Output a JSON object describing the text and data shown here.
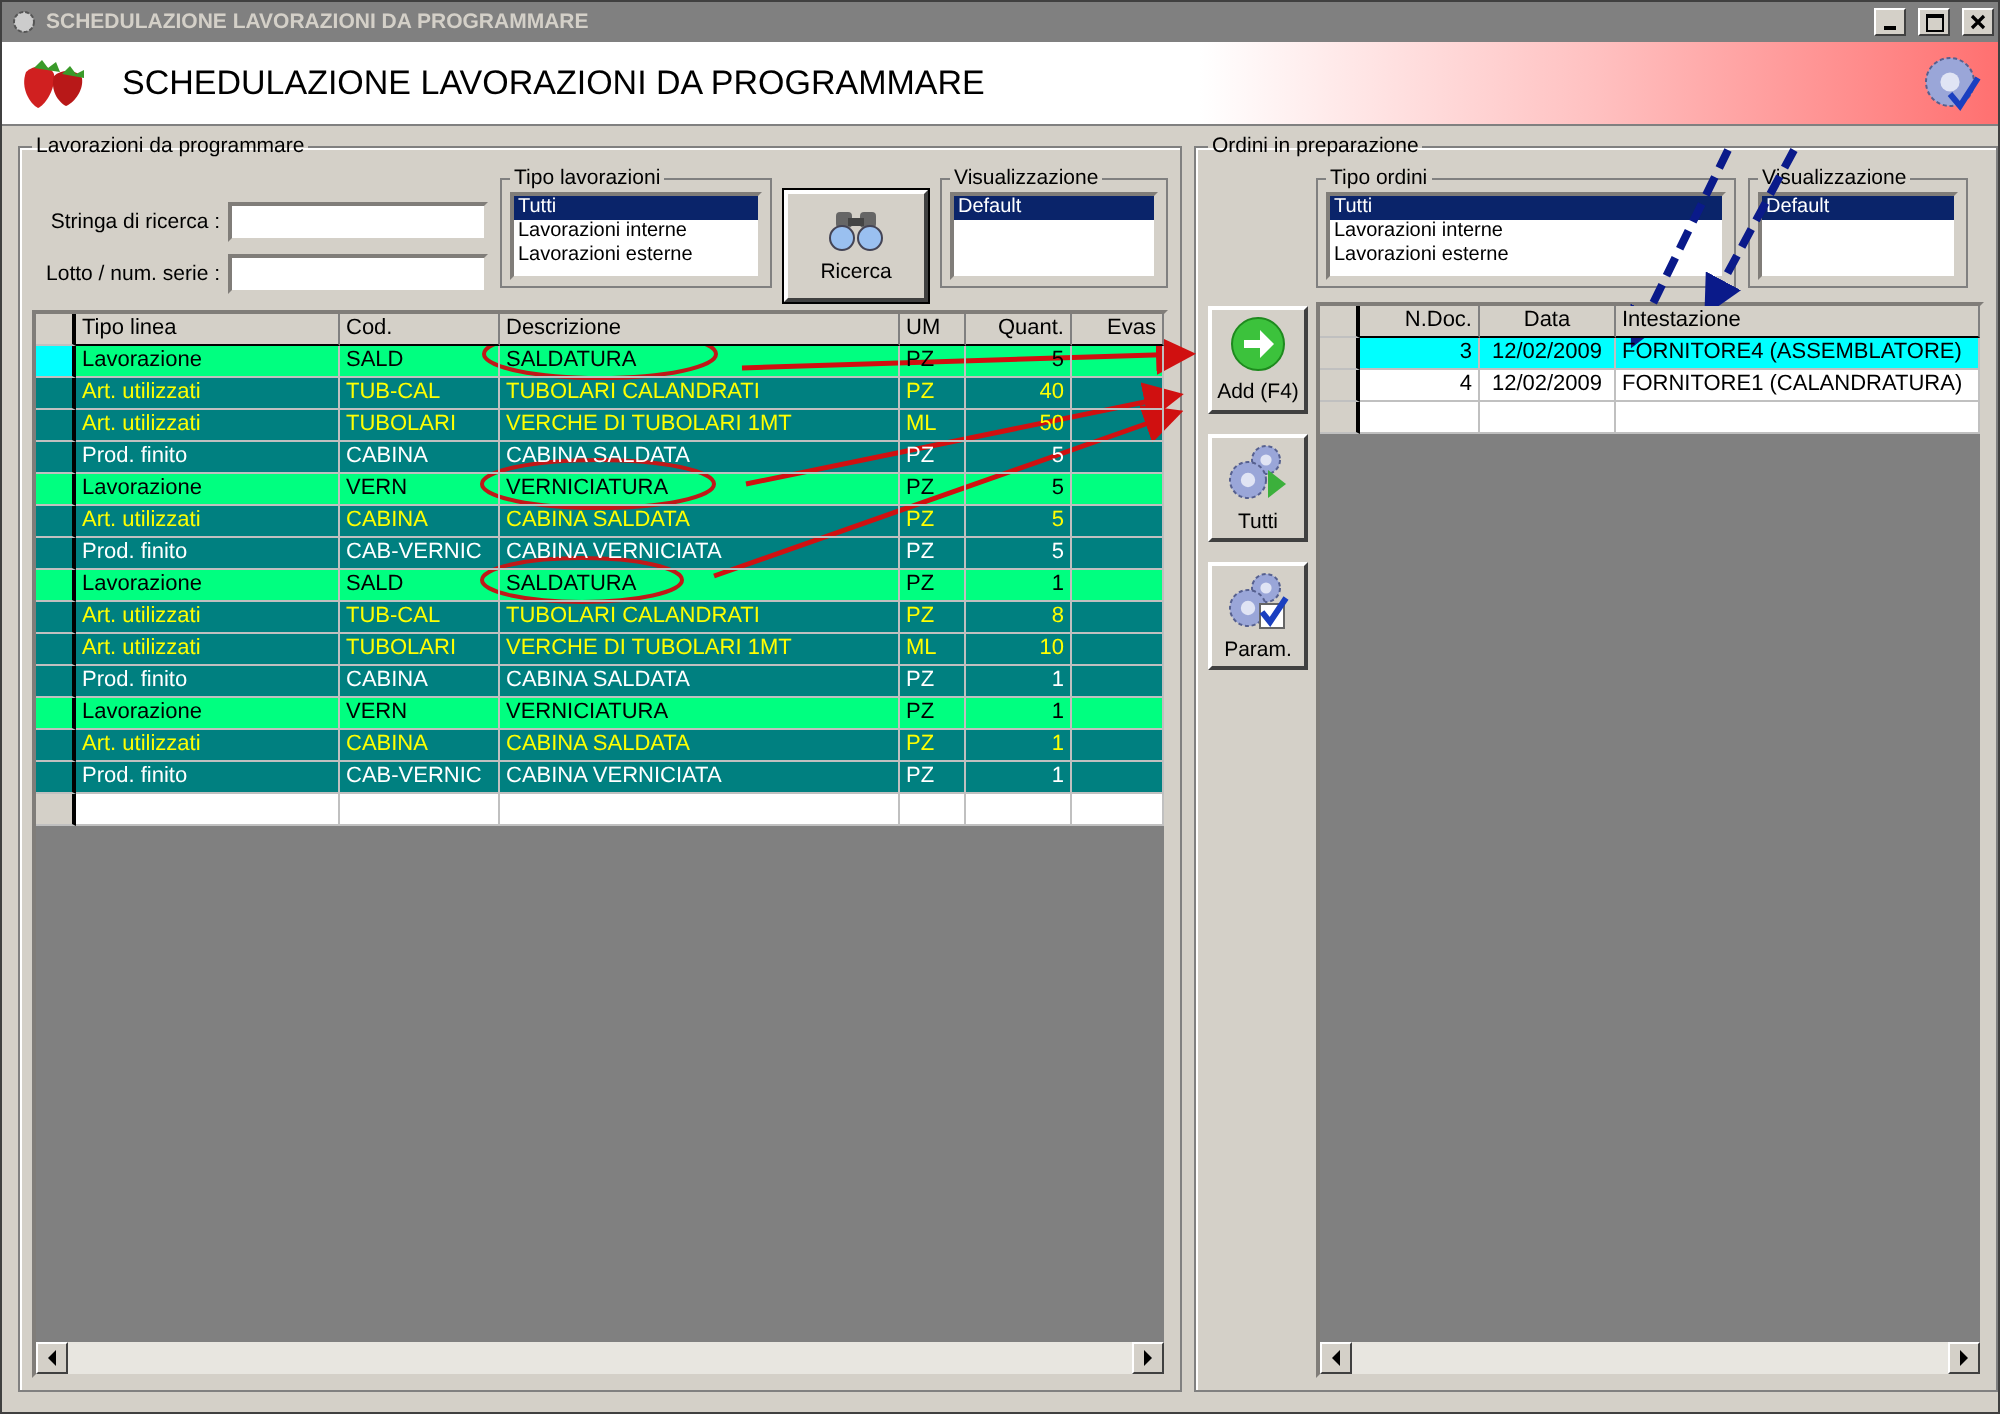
{
  "window": {
    "title": "SCHEDULAZIONE LAVORAZIONI DA PROGRAMMARE"
  },
  "header": {
    "title": "SCHEDULAZIONE LAVORAZIONI DA PROGRAMMARE"
  },
  "left_panel": {
    "title": "Lavorazioni da programmare",
    "fields": [
      {
        "label": "Stringa di ricerca :"
      },
      {
        "label": "Lotto / num. serie :"
      }
    ],
    "tipo_lavorazioni": {
      "title": "Tipo lavorazioni",
      "items": [
        {
          "label": "Tutti",
          "selected": true
        },
        {
          "label": "Lavorazioni interne",
          "selected": false
        },
        {
          "label": "Lavorazioni esterne",
          "selected": false
        }
      ]
    },
    "search_button": "Ricerca",
    "visualizzazione": {
      "title": "Visualizzazione",
      "items": [
        {
          "label": "Default",
          "selected": true
        }
      ]
    },
    "table": {
      "columns": [
        "Tipo linea",
        "Cod.",
        "Descrizione",
        "UM",
        "Quant.",
        "Evas"
      ],
      "rows": [
        {
          "kind": "lavorazione",
          "current": true,
          "cells": [
            "Lavorazione",
            "SALD",
            "SALDATURA",
            "PZ",
            "5"
          ]
        },
        {
          "kind": "materiale",
          "current": false,
          "cells": [
            "Art. utilizzati",
            "TUB-CAL",
            "TUBOLARI CALANDRATI",
            "PZ",
            "40"
          ]
        },
        {
          "kind": "materiale",
          "current": false,
          "cells": [
            "Art. utilizzati",
            "TUBOLARI",
            "VERCHE DI TUBOLARI 1MT",
            "ML",
            "50"
          ]
        },
        {
          "kind": "prodotto",
          "current": false,
          "cells": [
            "Prod. finito",
            "CABINA",
            "CABINA SALDATA",
            "PZ",
            "5"
          ]
        },
        {
          "kind": "lavorazione",
          "current": false,
          "cells": [
            "Lavorazione",
            "VERN",
            "VERNICIATURA",
            "PZ",
            "5"
          ]
        },
        {
          "kind": "materiale",
          "current": false,
          "cells": [
            "Art. utilizzati",
            "CABINA",
            "CABINA SALDATA",
            "PZ",
            "5"
          ]
        },
        {
          "kind": "prodotto",
          "current": false,
          "cells": [
            "Prod. finito",
            "CAB-VERNIC",
            "CABINA VERNICIATA",
            "PZ",
            "5"
          ]
        },
        {
          "kind": "lavorazione",
          "current": false,
          "cells": [
            "Lavorazione",
            "SALD",
            "SALDATURA",
            "PZ",
            "1"
          ]
        },
        {
          "kind": "materiale",
          "current": false,
          "cells": [
            "Art. utilizzati",
            "TUB-CAL",
            "TUBOLARI CALANDRATI",
            "PZ",
            "8"
          ]
        },
        {
          "kind": "materiale",
          "current": false,
          "cells": [
            "Art. utilizzati",
            "TUBOLARI",
            "VERCHE DI TUBOLARI 1MT",
            "ML",
            "10"
          ]
        },
        {
          "kind": "prodotto",
          "current": false,
          "cells": [
            "Prod. finito",
            "CABINA",
            "CABINA SALDATA",
            "PZ",
            "1"
          ]
        },
        {
          "kind": "lavorazione",
          "current": false,
          "cells": [
            "Lavorazione",
            "VERN",
            "VERNICIATURA",
            "PZ",
            "1"
          ]
        },
        {
          "kind": "materiale",
          "current": false,
          "cells": [
            "Art. utilizzati",
            "CABINA",
            "CABINA SALDATA",
            "PZ",
            "1"
          ]
        },
        {
          "kind": "prodotto",
          "current": false,
          "cells": [
            "Prod. finito",
            "CAB-VERNIC",
            "CABINA VERNICIATA",
            "PZ",
            "1"
          ]
        }
      ]
    }
  },
  "right_panel": {
    "title": "Ordini in preparazione",
    "tipo_ordini": {
      "title": "Tipo ordini",
      "items": [
        {
          "label": "Tutti",
          "selected": true
        },
        {
          "label": "Lavorazioni interne",
          "selected": false
        },
        {
          "label": "Lavorazioni esterne",
          "selected": false
        }
      ]
    },
    "visualizzazione": {
      "title": "Visualizzazione",
      "items": [
        {
          "label": "Default",
          "selected": true
        }
      ]
    },
    "buttons": [
      {
        "kind": "add",
        "label": "Add (F4)"
      },
      {
        "kind": "run",
        "label": "Tutti"
      },
      {
        "kind": "params",
        "label": "Param."
      }
    ],
    "table": {
      "columns": [
        "N.Doc.",
        "Data",
        "Intestazione"
      ],
      "rows": [
        {
          "selected": true,
          "cells": [
            "3",
            "12/02/2009",
            "FORNITORE4 (ASSEMBLATORE)"
          ]
        },
        {
          "selected": false,
          "cells": [
            "4",
            "12/02/2009",
            "FORNITORE1 (CALANDRATURA)"
          ]
        }
      ]
    }
  }
}
